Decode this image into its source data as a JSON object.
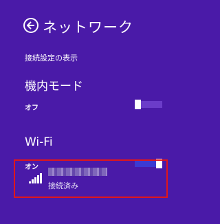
{
  "header": {
    "title": "ネットワーク"
  },
  "links": {
    "connection_settings": "接続設定の表示"
  },
  "airplane": {
    "label": "機内モード",
    "state": "オフ",
    "on": false
  },
  "wifi": {
    "label": "Wi-Fi",
    "state": "オン",
    "on": true
  },
  "network": {
    "name": "",
    "status": "接続済み",
    "signal_bars": 5
  },
  "colors": {
    "background": "#4a1aa8",
    "highlight_border": "#e0161b"
  }
}
